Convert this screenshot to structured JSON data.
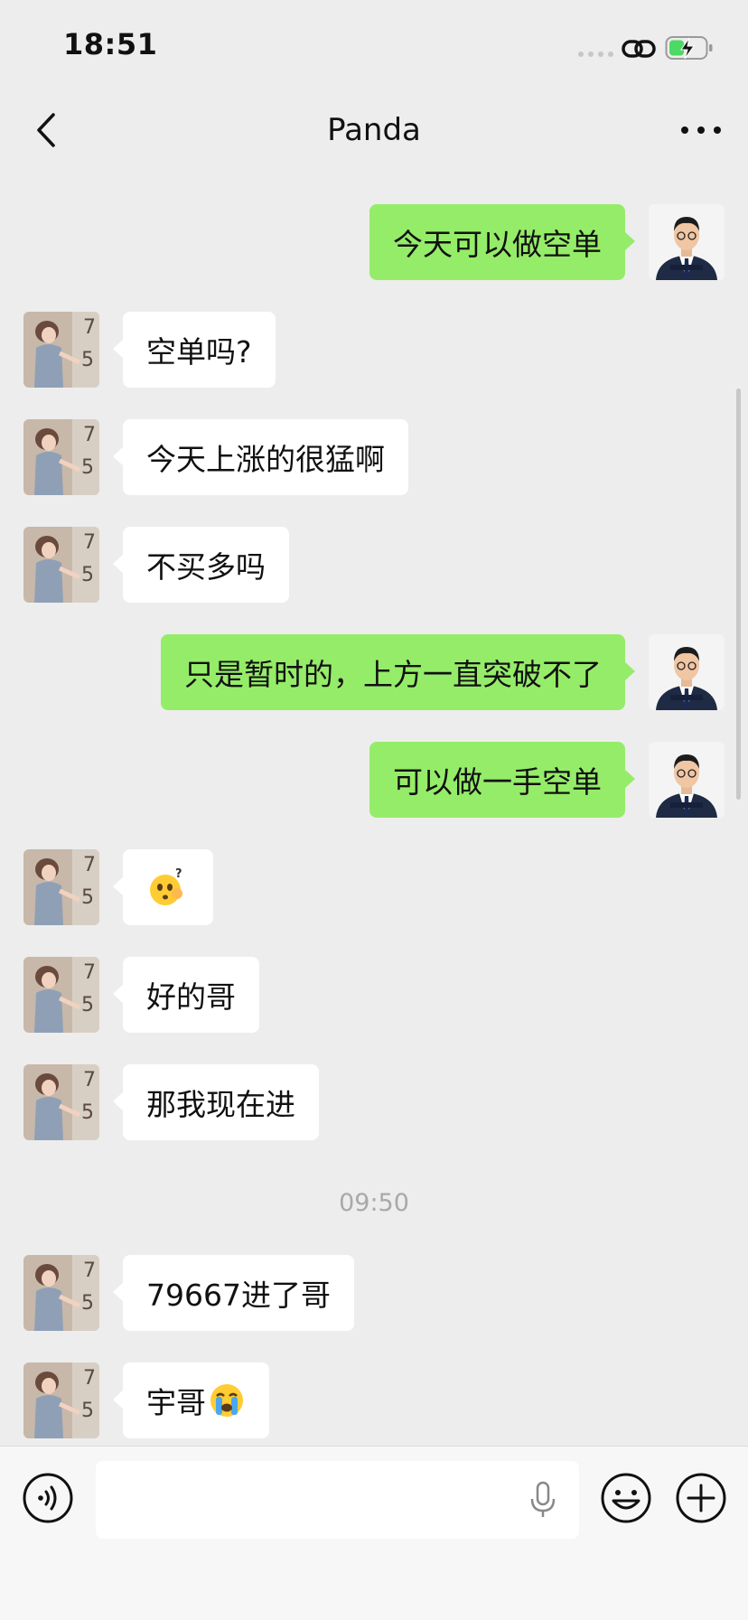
{
  "status_bar": {
    "time": "18:51"
  },
  "nav": {
    "title": "Panda",
    "more_label": "•••"
  },
  "messages": [
    {
      "side": "out",
      "text": "今天可以做空单",
      "sender_icon": "man-suit-avatar"
    },
    {
      "side": "in",
      "text": "空单吗?",
      "sender_icon": "woman-photo-avatar"
    },
    {
      "side": "in",
      "text": "今天上涨的很猛啊",
      "sender_icon": "woman-photo-avatar"
    },
    {
      "side": "in",
      "text": "不买多吗",
      "sender_icon": "woman-photo-avatar"
    },
    {
      "side": "out",
      "text": "只是暂时的，上方一直突破不了",
      "sender_icon": "man-suit-avatar"
    },
    {
      "side": "out",
      "text": "可以做一手空单",
      "sender_icon": "man-suit-avatar"
    },
    {
      "side": "in",
      "text": "🫣",
      "emoji_name": "confused-face-emoji",
      "sender_icon": "woman-photo-avatar"
    },
    {
      "side": "in",
      "text": "好的哥",
      "sender_icon": "woman-photo-avatar"
    },
    {
      "side": "in",
      "text": "那我现在进",
      "sender_icon": "woman-photo-avatar"
    },
    {
      "side": "in",
      "text": "79667进了哥",
      "sender_icon": "woman-photo-avatar"
    },
    {
      "side": "in",
      "text": "宇哥",
      "emoji_suffix": "😭",
      "emoji_name": "crying-face-emoji",
      "sender_icon": "woman-photo-avatar"
    }
  ],
  "time_divider": "09:50",
  "input": {
    "placeholder": "",
    "value": ""
  },
  "icons": {
    "back": "chevron-left-icon",
    "more": "more-dots-icon",
    "voice": "voice-toggle-icon",
    "mic": "mic-icon",
    "emoji": "smile-icon",
    "plus": "plus-icon",
    "link": "link-icon",
    "battery": "battery-charging-icon"
  },
  "colors": {
    "background": "#ededed",
    "outgoing_bubble": "#95ec69",
    "incoming_bubble": "#ffffff",
    "battery_fill": "#4cd964"
  }
}
